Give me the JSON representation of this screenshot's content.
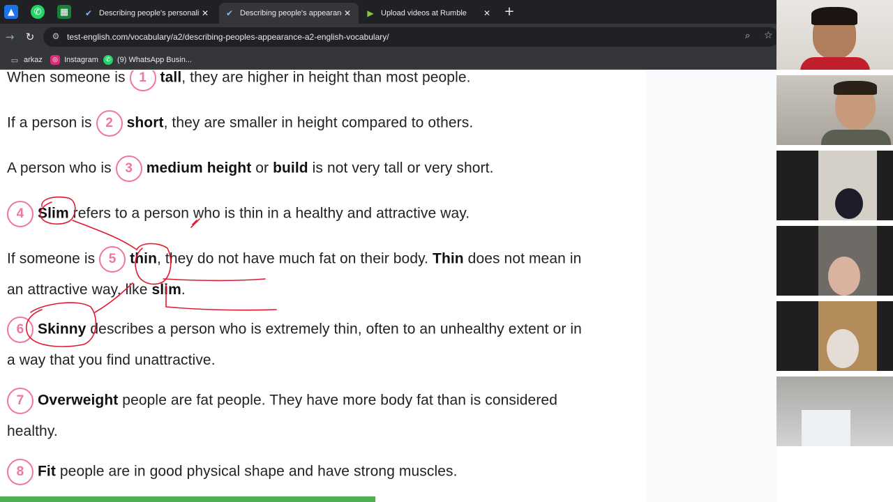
{
  "browser": {
    "tabs": [
      {
        "title": "Describing people's personality",
        "icon": "check-circle-icon",
        "active": false
      },
      {
        "title": "Describing people's appearance",
        "icon": "check-circle-icon",
        "active": true
      },
      {
        "title": "Upload videos at Rumble",
        "icon": "rumble-play-icon",
        "active": false
      }
    ],
    "url": "test-english.com/vocabulary/a2/describing-peoples-appearance-a2-english-vocabulary/",
    "bookmarks": [
      {
        "label": "arkaz",
        "icon": "folder-icon"
      },
      {
        "label": "Instagram",
        "icon": "instagram-icon"
      },
      {
        "label": "(9) WhatsApp Busin...",
        "icon": "whatsapp-icon"
      }
    ]
  },
  "lesson": {
    "items": [
      {
        "num": "1",
        "pre": "When someone is ",
        "bold1": "tall",
        "mid": "",
        "bold2": "",
        "post": ", they are higher in height than most people."
      },
      {
        "num": "2",
        "pre": "If a person is ",
        "bold1": "short",
        "mid": "",
        "bold2": "",
        "post": ", they are smaller in height compared to others."
      },
      {
        "num": "3",
        "pre": "A person who is ",
        "bold1": "medium height",
        "mid": " or ",
        "bold2": "build",
        "post": " is not very tall or very short."
      },
      {
        "num": "4",
        "bold1": "Slim",
        "post": " refers to a person who is thin in a healthy and attractive way."
      },
      {
        "num": "5",
        "pre": "If someone is ",
        "bold1": "thin",
        "post": ", they do not have much fat on their body. ",
        "bold2": "Thin",
        "post2": " does not mean in",
        "line2pre": "an attractive way, like ",
        "line2bold": "slim",
        "line2post": "."
      },
      {
        "num": "6",
        "bold1": "Skinny",
        "post": " describes a person who is extremely thin, often to an unhealthy extent or in",
        "line2": "a way that you find unattractive."
      },
      {
        "num": "7",
        "bold1": "Overweight",
        "post": " people are fat people. They have more body fat than is considered",
        "line2": "healthy."
      },
      {
        "num": "8",
        "bold1": "Fit",
        "post": " people are in good physical shape and have strong muscles."
      }
    ],
    "progress_fraction": 0.42
  },
  "colors": {
    "accent_pink": "#f0769a",
    "annotation_red": "#e0192f",
    "progress_green": "#4caf50",
    "chrome_dark": "#202124",
    "chrome_mid": "#35363a"
  }
}
